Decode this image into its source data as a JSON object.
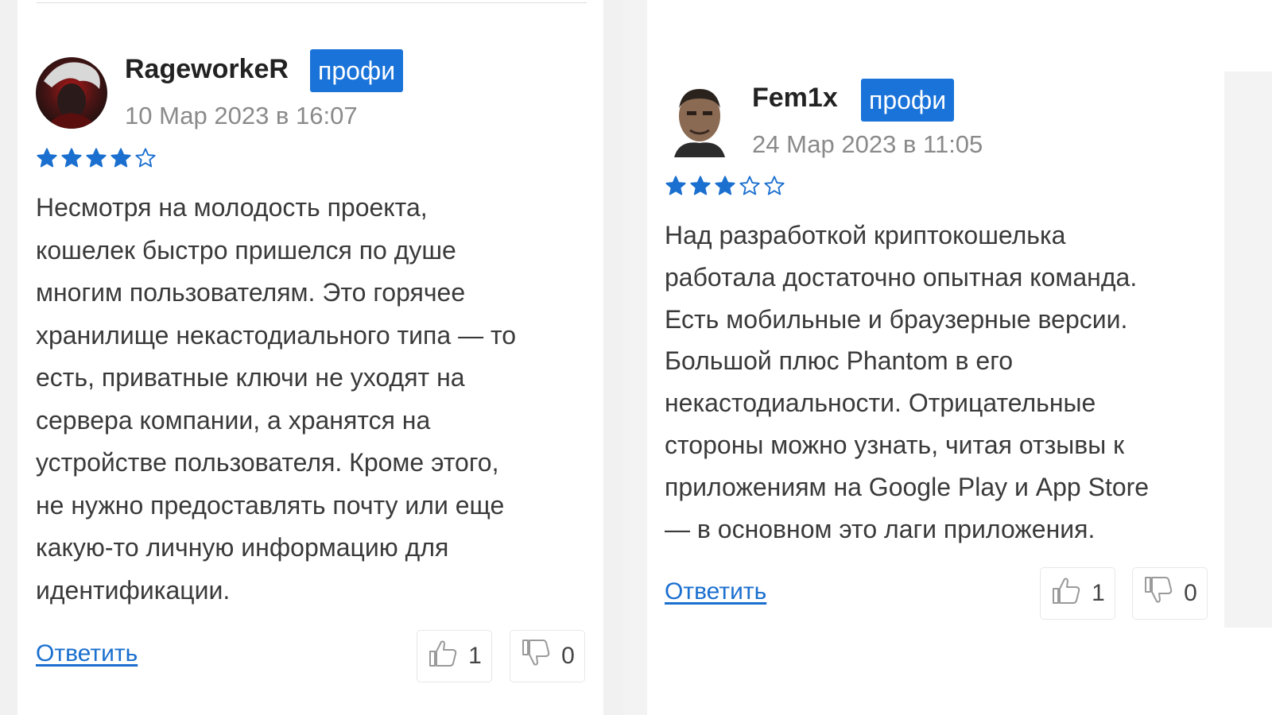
{
  "reviews": [
    {
      "username": "RageworkeR",
      "badge": "профи",
      "date": "10 Мар 2023 в 16:07",
      "rating": 4,
      "rating_max": 5,
      "text": "Несмотря на молодость проекта,\nкошелек быстро пришелся по душе\nмногим пользователям. Это горячее\nхранилище некастодиального типа — то\nесть, приватные ключи не уходят на\nсервера компании, а хранятся на\nустройстве пользователя. Кроме этого,\nне нужно предоставлять почту или еще\nкакую-то личную информацию для\nидентификации.",
      "reply_label": "Ответить",
      "likes": "1",
      "dislikes": "0"
    },
    {
      "username": "Fem1x",
      "badge": "профи",
      "date": "24 Мар 2023 в 11:05",
      "rating": 3,
      "rating_max": 5,
      "text": "Над разработкой криптокошелька\nработала достаточно опытная команда.\nЕсть мобильные и браузерные версии.\nБольшой плюс Phantom в его\nнекастодиальности. Отрицательные\nстороны можно узнать, читая отзывы к\nприложениям на Google Play и App Store\n— в основном это лаги приложения.",
      "reply_label": "Ответить",
      "likes": "1",
      "dislikes": "0"
    }
  ],
  "colors": {
    "accent": "#1a73d9",
    "star": "#1a6fcf",
    "link": "#1a6fcf",
    "date": "#8a8a8a"
  },
  "icons": {
    "like": "thumbs-up-icon",
    "dislike": "thumbs-down-icon",
    "star_filled": "star-filled-icon",
    "star_empty": "star-outline-icon"
  }
}
